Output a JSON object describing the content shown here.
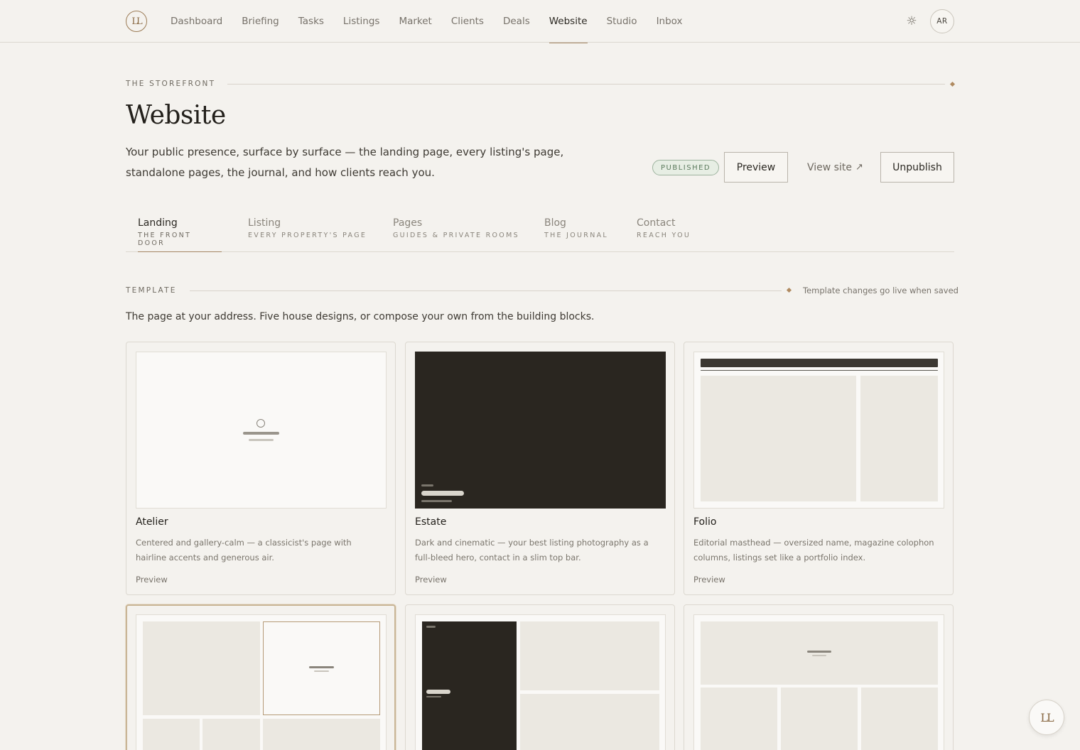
{
  "brand": {
    "logo_text": "LL"
  },
  "nav": {
    "items": [
      {
        "label": "Dashboard",
        "active": false
      },
      {
        "label": "Briefing",
        "active": false
      },
      {
        "label": "Tasks",
        "active": false
      },
      {
        "label": "Listings",
        "active": false
      },
      {
        "label": "Market",
        "active": false
      },
      {
        "label": "Clients",
        "active": false
      },
      {
        "label": "Deals",
        "active": false
      },
      {
        "label": "Website",
        "active": true
      },
      {
        "label": "Studio",
        "active": false
      },
      {
        "label": "Inbox",
        "active": false
      }
    ],
    "theme_icon": "sun-icon",
    "avatar_initials": "AR"
  },
  "header": {
    "eyebrow": "THE STOREFRONT",
    "title": "Website",
    "subtitle": "Your public presence, surface by surface — the landing page, every listing's page, standalone pages, the journal, and how clients reach you.",
    "status_badge": "PUBLISHED",
    "preview_label": "Preview",
    "view_site_label": "View site",
    "view_site_icon": "↗",
    "unpublish_label": "Unpublish"
  },
  "tabs": [
    {
      "label": "Landing",
      "sub": "THE FRONT DOOR",
      "active": true
    },
    {
      "label": "Listing",
      "sub": "EVERY PROPERTY'S PAGE",
      "active": false
    },
    {
      "label": "Pages",
      "sub": "GUIDES & PRIVATE ROOMS",
      "active": false
    },
    {
      "label": "Blog",
      "sub": "THE JOURNAL",
      "active": false
    },
    {
      "label": "Contact",
      "sub": "REACH YOU",
      "active": false
    }
  ],
  "template": {
    "label": "TEMPLATE",
    "note": "Template changes go live when saved",
    "description": "The page at your address. Five house designs, or compose your own from the building blocks.",
    "cards": [
      {
        "name": "Atelier",
        "description": "Centered and gallery-calm — a classicist's page with hairline accents and generous air.",
        "preview": "Preview",
        "selected": false
      },
      {
        "name": "Estate",
        "description": "Dark and cinematic — your best listing photography as a full-bleed hero, contact in a slim top bar.",
        "preview": "Preview",
        "selected": false
      },
      {
        "name": "Folio",
        "description": "Editorial masthead — oversized name, magazine colophon columns, listings set like a portfolio index.",
        "preview": "Preview",
        "selected": false
      },
      {
        "name": "",
        "description": "",
        "preview": "",
        "selected": true
      },
      {
        "name": "",
        "description": "",
        "preview": "",
        "selected": false
      },
      {
        "name": "",
        "description": "",
        "preview": "",
        "selected": false
      }
    ]
  },
  "colors": {
    "accent": "#a48663",
    "background": "#f4f2ee",
    "published": "#5b7a5d",
    "dark": "#2a2620"
  }
}
